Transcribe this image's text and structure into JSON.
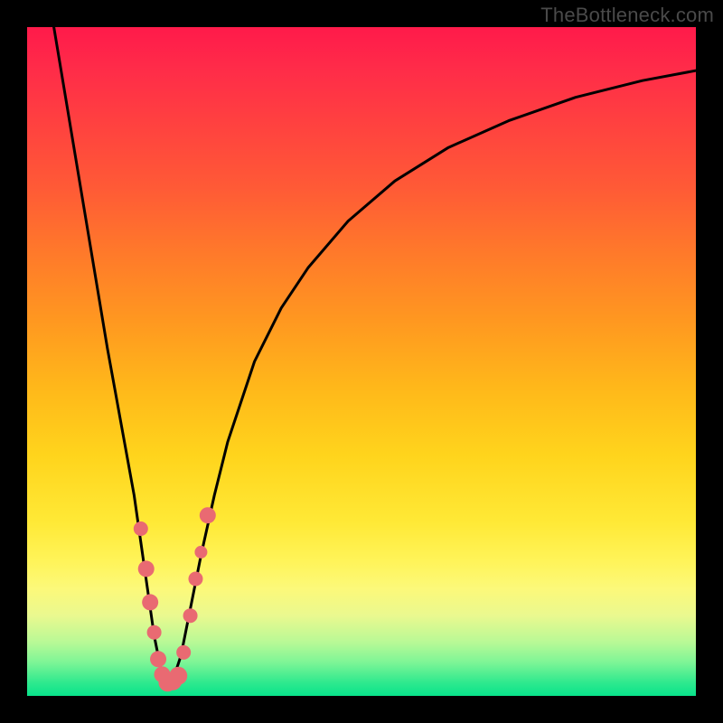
{
  "watermark": "TheBottleneck.com",
  "colors": {
    "frame_bg": "#000000",
    "curve_stroke": "#000000",
    "marker_fill": "#e96a72",
    "gradient_top": "#ff1a4a",
    "gradient_bottom": "#08e38b"
  },
  "chart_data": {
    "type": "line",
    "title": "",
    "xlabel": "",
    "ylabel": "",
    "xlim": [
      0,
      100
    ],
    "ylim": [
      0,
      100
    ],
    "notes": "V-shaped bottleneck curve. Y≈0 is best (green), Y≈100 is worst (red). Valley bottom near x≈21.",
    "series": [
      {
        "name": "bottleneck-curve",
        "x": [
          4,
          6,
          8,
          10,
          12,
          14,
          16,
          18,
          19,
          20,
          21,
          22,
          23,
          24,
          26,
          28,
          30,
          34,
          38,
          42,
          48,
          55,
          63,
          72,
          82,
          92,
          100
        ],
        "y": [
          100,
          88,
          76,
          64,
          52,
          41,
          30,
          16,
          9,
          4,
          2,
          3,
          6,
          11,
          21,
          30,
          38,
          50,
          58,
          64,
          71,
          77,
          82,
          86,
          89.5,
          92,
          93.5
        ]
      }
    ],
    "markers": {
      "name": "highlighted-points",
      "color": "#e96a72",
      "points": [
        {
          "x": 17.0,
          "y": 25.0,
          "r": 8
        },
        {
          "x": 17.8,
          "y": 19.0,
          "r": 9
        },
        {
          "x": 18.4,
          "y": 14.0,
          "r": 9
        },
        {
          "x": 19.0,
          "y": 9.5,
          "r": 8
        },
        {
          "x": 19.6,
          "y": 5.5,
          "r": 9
        },
        {
          "x": 20.2,
          "y": 3.2,
          "r": 9
        },
        {
          "x": 21.0,
          "y": 2.0,
          "r": 10
        },
        {
          "x": 21.8,
          "y": 2.2,
          "r": 10
        },
        {
          "x": 22.6,
          "y": 3.0,
          "r": 10
        },
        {
          "x": 23.4,
          "y": 6.5,
          "r": 8
        },
        {
          "x": 24.4,
          "y": 12.0,
          "r": 8
        },
        {
          "x": 25.2,
          "y": 17.5,
          "r": 8
        },
        {
          "x": 26.0,
          "y": 21.5,
          "r": 7
        },
        {
          "x": 27.0,
          "y": 27.0,
          "r": 9
        }
      ]
    }
  }
}
